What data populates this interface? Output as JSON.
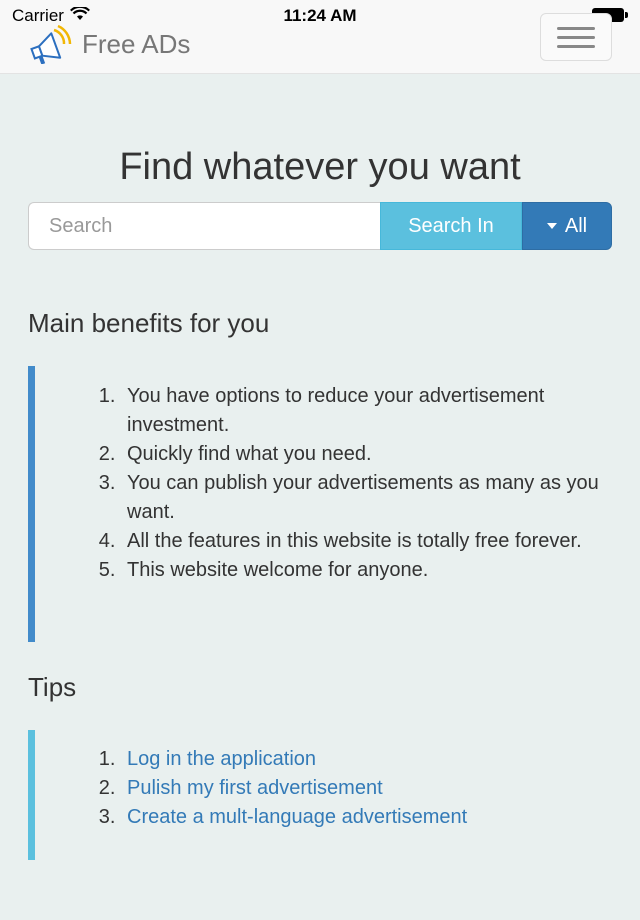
{
  "status_bar": {
    "carrier": "Carrier",
    "time": "11:24 AM"
  },
  "navbar": {
    "brand": "Free ADs",
    "logo_icon": "megaphone-icon",
    "menu_icon": "hamburger-menu-icon"
  },
  "hero": {
    "title": "Find whatever you want",
    "search": {
      "placeholder": "Search",
      "value": "",
      "button_label": "Search In",
      "category_label": "All"
    }
  },
  "benefits": {
    "title": "Main benefits for you",
    "items": [
      "You have options to reduce your advertisement investment.",
      "Quickly find what you need.",
      "You can publish your advertisements as many as you want.",
      "All the features in this website is totally free forever.",
      "This website welcome for anyone."
    ]
  },
  "tips": {
    "title": "Tips",
    "items": [
      "Log in the application",
      "Pulish my first advertisement",
      "Create a mult-language advertisement"
    ]
  },
  "colors": {
    "background": "#e9f0ef",
    "info": "#5bc0de",
    "primary": "#337ab7",
    "benefits_border": "#428bca",
    "tips_border": "#5bc0de"
  }
}
